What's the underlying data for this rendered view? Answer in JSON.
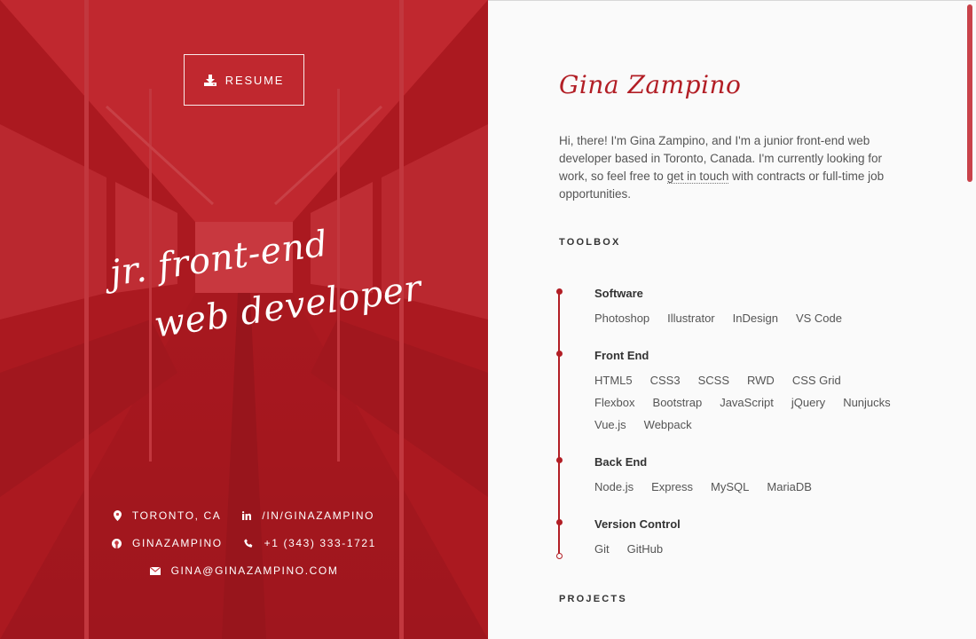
{
  "hero": {
    "resume_label": "RESUME",
    "tagline_line1": "jr. front-end",
    "tagline_line2": "web developer",
    "contacts": [
      {
        "icon": "location-pin-icon",
        "text": "TORONTO, CA"
      },
      {
        "icon": "linkedin-icon",
        "text": "/IN/GINAZAMPINO"
      },
      {
        "icon": "github-icon",
        "text": "GINAZAMPINO"
      },
      {
        "icon": "phone-icon",
        "text": "+1 (343) 333-1721"
      },
      {
        "icon": "envelope-icon",
        "text": "GINA@GINAZAMPINO.COM"
      }
    ]
  },
  "about": {
    "name": "Gina Zampino",
    "intro_before": "Hi, there! I'm Gina Zampino, and I'm a junior front-end web developer based in Toronto, Canada. I'm currently looking for work, so feel free to ",
    "intro_link": "get in touch",
    "intro_after": " with contracts or full-time job opportunities."
  },
  "toolbox": {
    "title": "TOOLBOX",
    "groups": [
      {
        "title": "Software",
        "items": [
          "Photoshop",
          "Illustrator",
          "InDesign",
          "VS Code"
        ]
      },
      {
        "title": "Front End",
        "items": [
          "HTML5",
          "CSS3",
          "SCSS",
          "RWD",
          "CSS Grid",
          "Flexbox",
          "Bootstrap",
          "JavaScript",
          "jQuery",
          "Nunjucks",
          "Vue.js",
          "Webpack"
        ]
      },
      {
        "title": "Back End",
        "items": [
          "Node.js",
          "Express",
          "MySQL",
          "MariaDB"
        ]
      },
      {
        "title": "Version Control",
        "items": [
          "Git",
          "GitHub"
        ]
      }
    ]
  },
  "projects": {
    "title": "PROJECTS"
  },
  "colors": {
    "accent": "#b21e25",
    "hero_overlay": "#be1e26"
  }
}
